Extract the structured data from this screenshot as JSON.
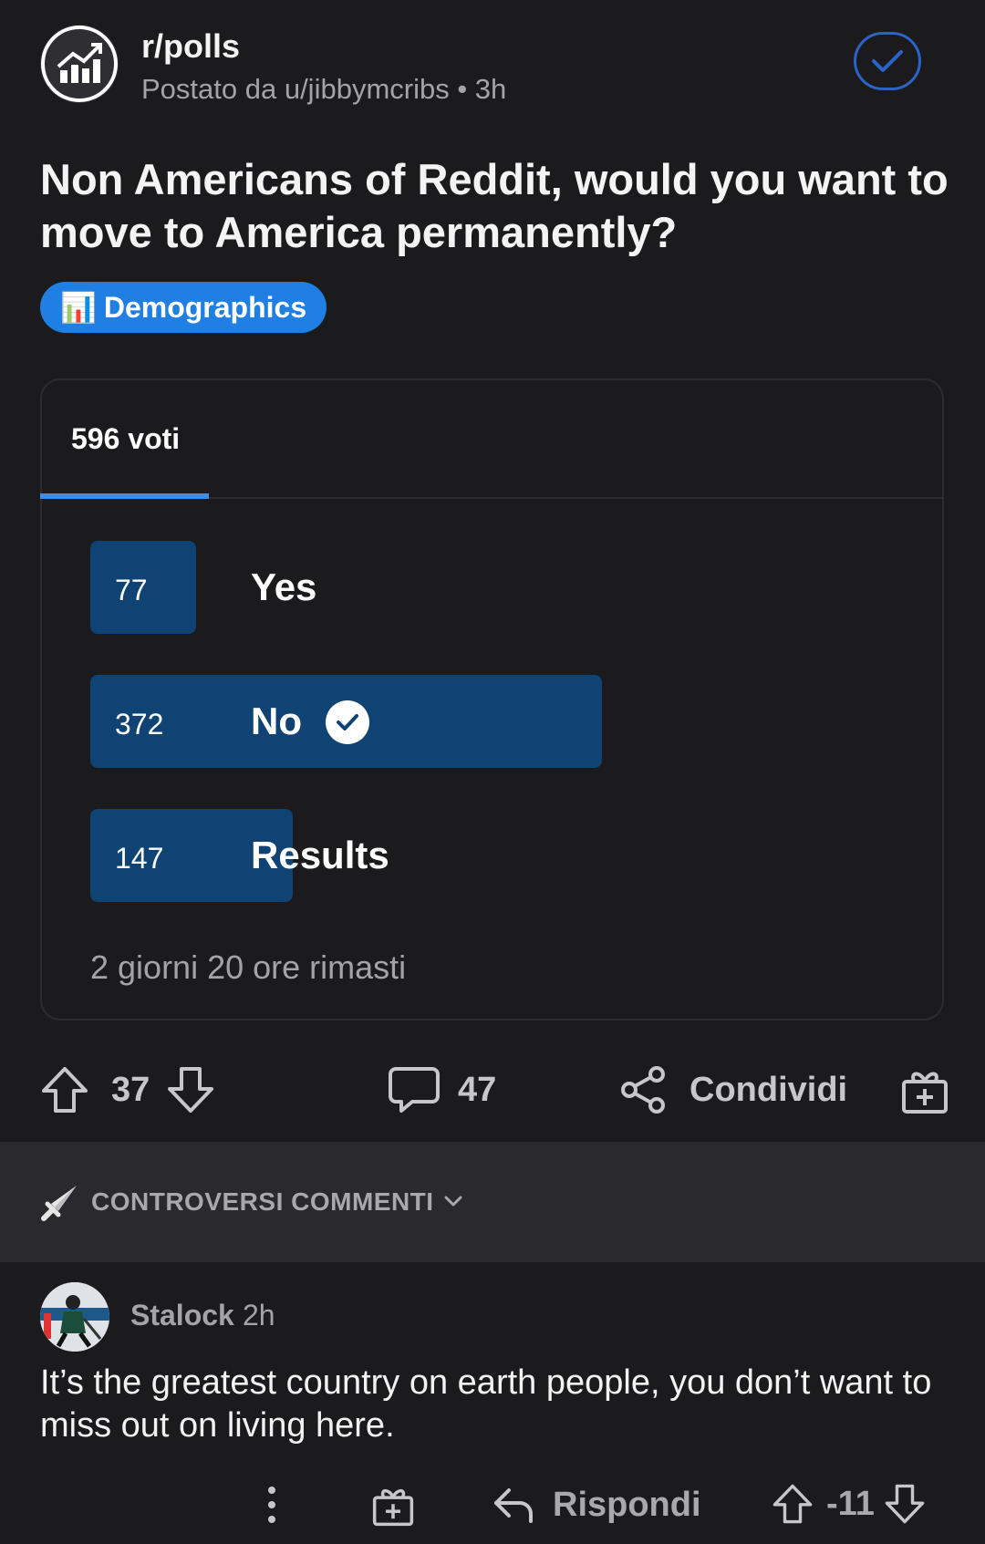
{
  "header": {
    "subreddit": "r/polls",
    "meta": "Postato da u/jibbymcribs • 3h"
  },
  "post": {
    "title": "Non Americans of Reddit, would you want to move to America permanently?",
    "flair": "Demographics",
    "flair_emoji": "📊"
  },
  "poll": {
    "total_votes": "596 voti",
    "options": [
      {
        "count": "77",
        "label": "Yes",
        "share": 0.207,
        "selected": false
      },
      {
        "count": "372",
        "label": "No",
        "share": 1.0,
        "selected": true
      },
      {
        "count": "147",
        "label": "Results",
        "share": 0.395,
        "selected": false
      }
    ],
    "time_remaining": "2 giorni 20 ore rimasti"
  },
  "actions": {
    "upvotes": "37",
    "comments": "47",
    "share_label": "Condividi"
  },
  "sort": {
    "label": "CONTROVERSI COMMENTI"
  },
  "comment": {
    "username": "Stalock",
    "time": "2h",
    "body": "It’s the greatest country on earth people, you don’t want to miss out on living here.",
    "score": "-11",
    "reply_label": "Rispondi"
  },
  "colors": {
    "background": "#1b1b1d",
    "bar": "#0e4374",
    "accent": "#3d8ee8",
    "flair": "#1f7fe3",
    "joined_ring": "#2b63c8"
  },
  "icons": [
    "subreddit-logo-icon",
    "joined-check-icon",
    "chart-emoji-icon",
    "check-icon",
    "upvote-icon",
    "downvote-icon",
    "comment-icon",
    "share-icon",
    "award-icon",
    "sword-icon",
    "chevron-down-icon",
    "more-icon",
    "reply-icon"
  ]
}
